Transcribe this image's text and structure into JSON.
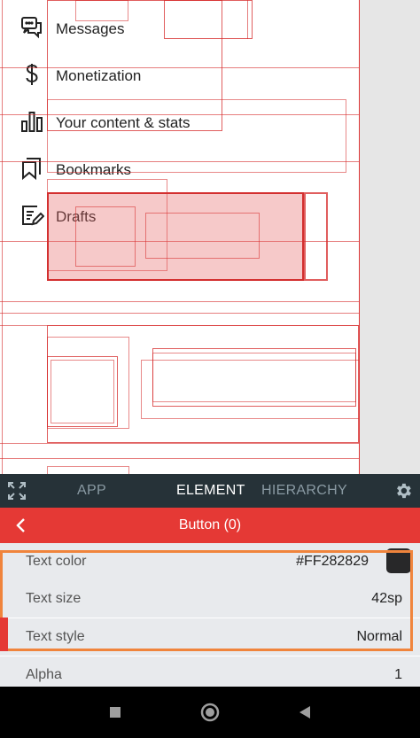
{
  "menu": {
    "items": [
      {
        "label": "Messages",
        "icon": "chat-bubbles-icon"
      },
      {
        "label": "Monetization",
        "icon": "dollar-icon"
      },
      {
        "label": "Your content & stats",
        "icon": "bar-chart-icon"
      },
      {
        "label": "Bookmarks",
        "icon": "bookmarks-icon"
      },
      {
        "label": "Drafts",
        "icon": "drafts-icon"
      }
    ]
  },
  "inspector": {
    "tabs": [
      {
        "label": "APP",
        "active": false
      },
      {
        "label": "ELEMENT",
        "active": true
      },
      {
        "label": "HIERARCHY",
        "active": false
      }
    ],
    "title": "Button (0)",
    "properties": [
      {
        "name": "Text color",
        "value": "#FF282829"
      },
      {
        "name": "Text size",
        "value": "42sp"
      },
      {
        "name": "Text style",
        "value": "Normal"
      },
      {
        "name": "Alpha",
        "value": "1"
      }
    ]
  },
  "colors": {
    "tab_bar": "#263238",
    "title_bar": "#e53935",
    "selection_frame": "#f0843c",
    "text_color_swatch": "#282829"
  }
}
